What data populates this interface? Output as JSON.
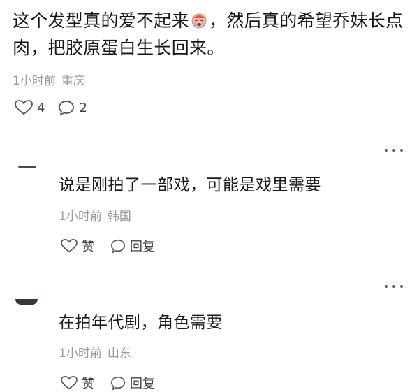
{
  "post": {
    "text_part1": "这个发型真的爱不起来",
    "text_part2": "，然后真的希望乔妹长点肉，把胶原蛋白生长回来。",
    "emoji": "crying-face-emoji",
    "time": "1小时前",
    "location": "重庆",
    "like_count": "4",
    "comment_count": "2"
  },
  "replies": [
    {
      "text": "说是刚拍了一部戏，可能是戏里需要",
      "time": "1小时前",
      "location": "韩国",
      "like_label": "赞",
      "reply_label": "回复"
    },
    {
      "text": "在拍年代剧，角色需要",
      "time": "1小时前",
      "location": "山东",
      "like_label": "赞",
      "reply_label": "回复"
    }
  ],
  "icons": {
    "like": "heart-outline-icon",
    "comment": "speech-bubble-icon",
    "more": "more-dots-icon"
  },
  "colors": {
    "text": "#161616",
    "meta": "#9a9a9a",
    "icon": "#555555"
  }
}
